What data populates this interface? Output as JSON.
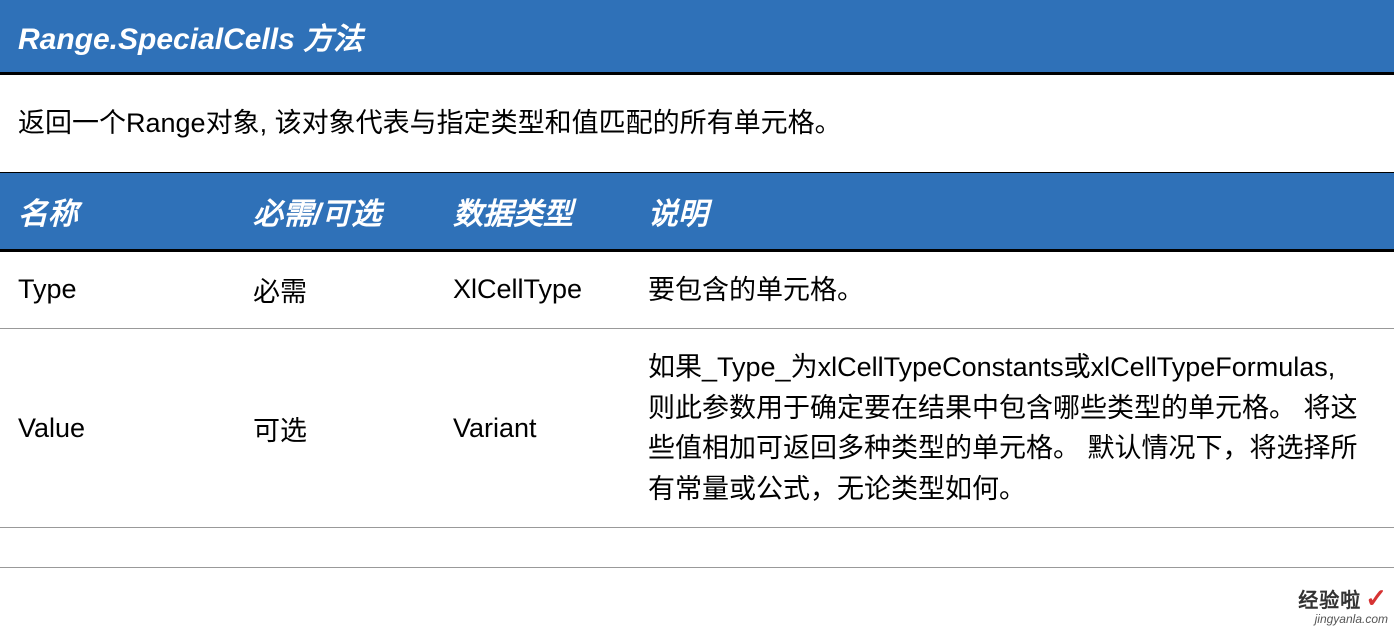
{
  "title": "Range.SpecialCells 方法",
  "description": "返回一个Range对象, 该对象代表与指定类型和值匹配的所有单元格。",
  "headers": {
    "name": "名称",
    "required": "必需/可选",
    "datatype": "数据类型",
    "description": "说明"
  },
  "rows": [
    {
      "name": "Type",
      "required": "必需",
      "datatype": "XlCellType",
      "description": "要包含的单元格。"
    },
    {
      "name": "Value",
      "required": "可选",
      "datatype": "Variant",
      "description": "如果_Type_为xlCellTypeConstants或xlCellTypeFormulas, 则此参数用于确定要在结果中包含哪些类型的单元格。 将这些值相加可返回多种类型的单元格。 默认情况下，将选择所有常量或公式，无论类型如何。"
    }
  ],
  "watermark": {
    "top": "经验啦",
    "check": "✓",
    "bottom": "jingyanla.com"
  }
}
